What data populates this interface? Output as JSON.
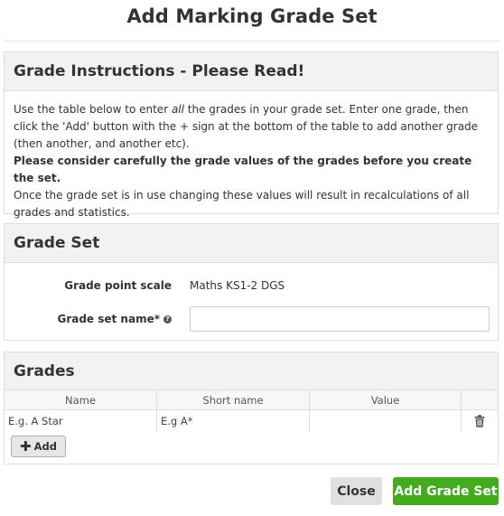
{
  "modal": {
    "title": "Add Marking Grade Set"
  },
  "instructions": {
    "heading": "Grade Instructions - Please Read!",
    "line1_pre": "Use the table below to enter ",
    "line1_em": "all",
    "line1_post": " the grades in your grade set. Enter one grade, then click the 'Add' button with the + sign at the bottom of the table to add another grade (then another, and another etc).",
    "bold_line": "Please consider carefully the grade values of the grades before you create the set.",
    "final_line": "Once the grade set is in use changing these values will result in recalculations of all grades and statistics."
  },
  "grade_set": {
    "heading": "Grade Set",
    "point_scale_label": "Grade point scale",
    "point_scale_value": "Maths KS1-2 DGS",
    "name_label": "Grade set name*",
    "name_value": ""
  },
  "grades": {
    "heading": "Grades",
    "columns": [
      "Name",
      "Short name",
      "Value"
    ],
    "rows": [
      {
        "name_placeholder": "E.g. A Star",
        "short_placeholder": "E.g A*",
        "value": ""
      }
    ],
    "add_label": "Add"
  },
  "footer": {
    "close_label": "Close",
    "submit_label": "Add Grade Set"
  },
  "colors": {
    "primary": "#43ac1e",
    "panel_heading_bg": "#f2f2f2"
  },
  "icons": {
    "help": "question-circle-icon",
    "delete": "trash-icon",
    "add": "plus-icon"
  }
}
